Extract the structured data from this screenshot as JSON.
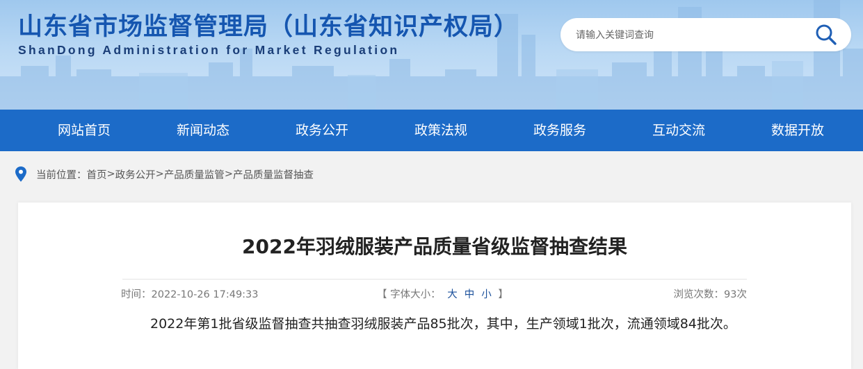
{
  "header": {
    "title": "山东省市场监督管理局（山东省知识产权局）",
    "subtitle": "ShanDong Administration for Market Regulation",
    "search_placeholder": "请输入关键词查询",
    "search_icon": "magnifier-icon"
  },
  "nav": {
    "items": [
      {
        "label": "网站首页"
      },
      {
        "label": "新闻动态"
      },
      {
        "label": "政务公开"
      },
      {
        "label": "政策法规"
      },
      {
        "label": "政务服务"
      },
      {
        "label": "互动交流"
      },
      {
        "label": "数据开放"
      }
    ]
  },
  "breadcrumb": {
    "prefix": "当前位置：",
    "items": [
      "首页",
      "政务公开",
      "产品质量监管",
      "产品质量监督抽查"
    ],
    "separator": ">"
  },
  "article": {
    "title": "2022年羽绒服装产品质量省级监督抽查结果",
    "time_label": "时间：",
    "time_value": "2022-10-26 17:49:33",
    "font_size_label": "字体大小：",
    "font_size_options": [
      "大",
      "中",
      "小"
    ],
    "views_label": "浏览次数：",
    "views_value": "93",
    "views_unit": "次",
    "body": "2022年第1批省级监督抽查共抽查羽绒服装产品85批次，其中，生产领域1批次，流通领域84批次。"
  },
  "colors": {
    "brand_blue": "#1556b0",
    "nav_blue": "#1c6bc8",
    "link_blue": "#1a4f9a"
  }
}
